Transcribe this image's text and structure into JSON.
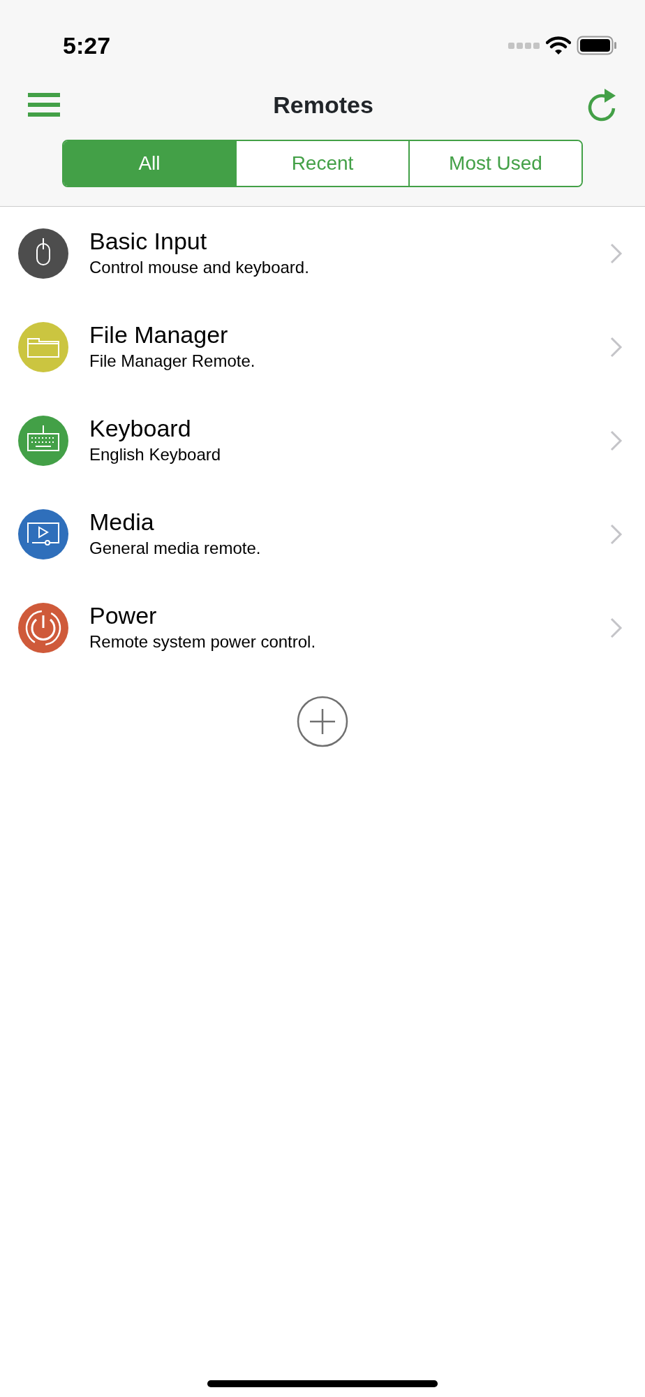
{
  "status_bar": {
    "time": "5:27"
  },
  "nav": {
    "title": "Remotes"
  },
  "tabs": [
    {
      "label": "All",
      "selected": true
    },
    {
      "label": "Recent",
      "selected": false
    },
    {
      "label": "Most Used",
      "selected": false
    }
  ],
  "remotes": [
    {
      "kind": "mouse",
      "title": "Basic Input",
      "subtitle": "Control mouse and keyboard.",
      "color": "#4d4d4d"
    },
    {
      "kind": "folder",
      "title": "File Manager",
      "subtitle": "File Manager Remote.",
      "color": "#cbc540"
    },
    {
      "kind": "keyboard",
      "title": "Keyboard",
      "subtitle": "English Keyboard",
      "color": "#43a047"
    },
    {
      "kind": "media",
      "title": "Media",
      "subtitle": "General media remote.",
      "color": "#2f6fbb"
    },
    {
      "kind": "power",
      "title": "Power",
      "subtitle": "Remote system power control.",
      "color": "#cf5a3a"
    }
  ]
}
